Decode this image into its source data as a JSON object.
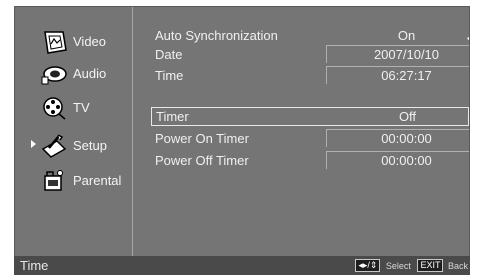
{
  "sidebar": {
    "items": [
      {
        "label": "Video",
        "icon": "video-icon",
        "selected": false
      },
      {
        "label": "Audio",
        "icon": "audio-icon",
        "selected": false
      },
      {
        "label": "TV",
        "icon": "tv-icon",
        "selected": false
      },
      {
        "label": "Setup",
        "icon": "setup-icon",
        "selected": true
      },
      {
        "label": "Parental",
        "icon": "parental-icon",
        "selected": false
      }
    ]
  },
  "settings": {
    "auto_sync": {
      "label": "Auto Synchronization",
      "value": "On"
    },
    "date": {
      "label": "Date",
      "value": "2007/10/10"
    },
    "time": {
      "label": "Time",
      "value": "06:27:17"
    },
    "timer": {
      "label": "Timer",
      "value": "Off"
    },
    "power_on_timer": {
      "label": "Power On Timer",
      "value": "00:00:00"
    },
    "power_off_timer": {
      "label": "Power Off Timer",
      "value": "00:00:00"
    }
  },
  "status_bar": {
    "title": "Time",
    "nav_key": "◂▸/⇕",
    "select_label": "Select",
    "exit_key": "EXIT",
    "back_label": "Back"
  },
  "colors": {
    "panel": "#757575",
    "status_bar": "#4a4a4a",
    "text": "#f0f0f0"
  }
}
